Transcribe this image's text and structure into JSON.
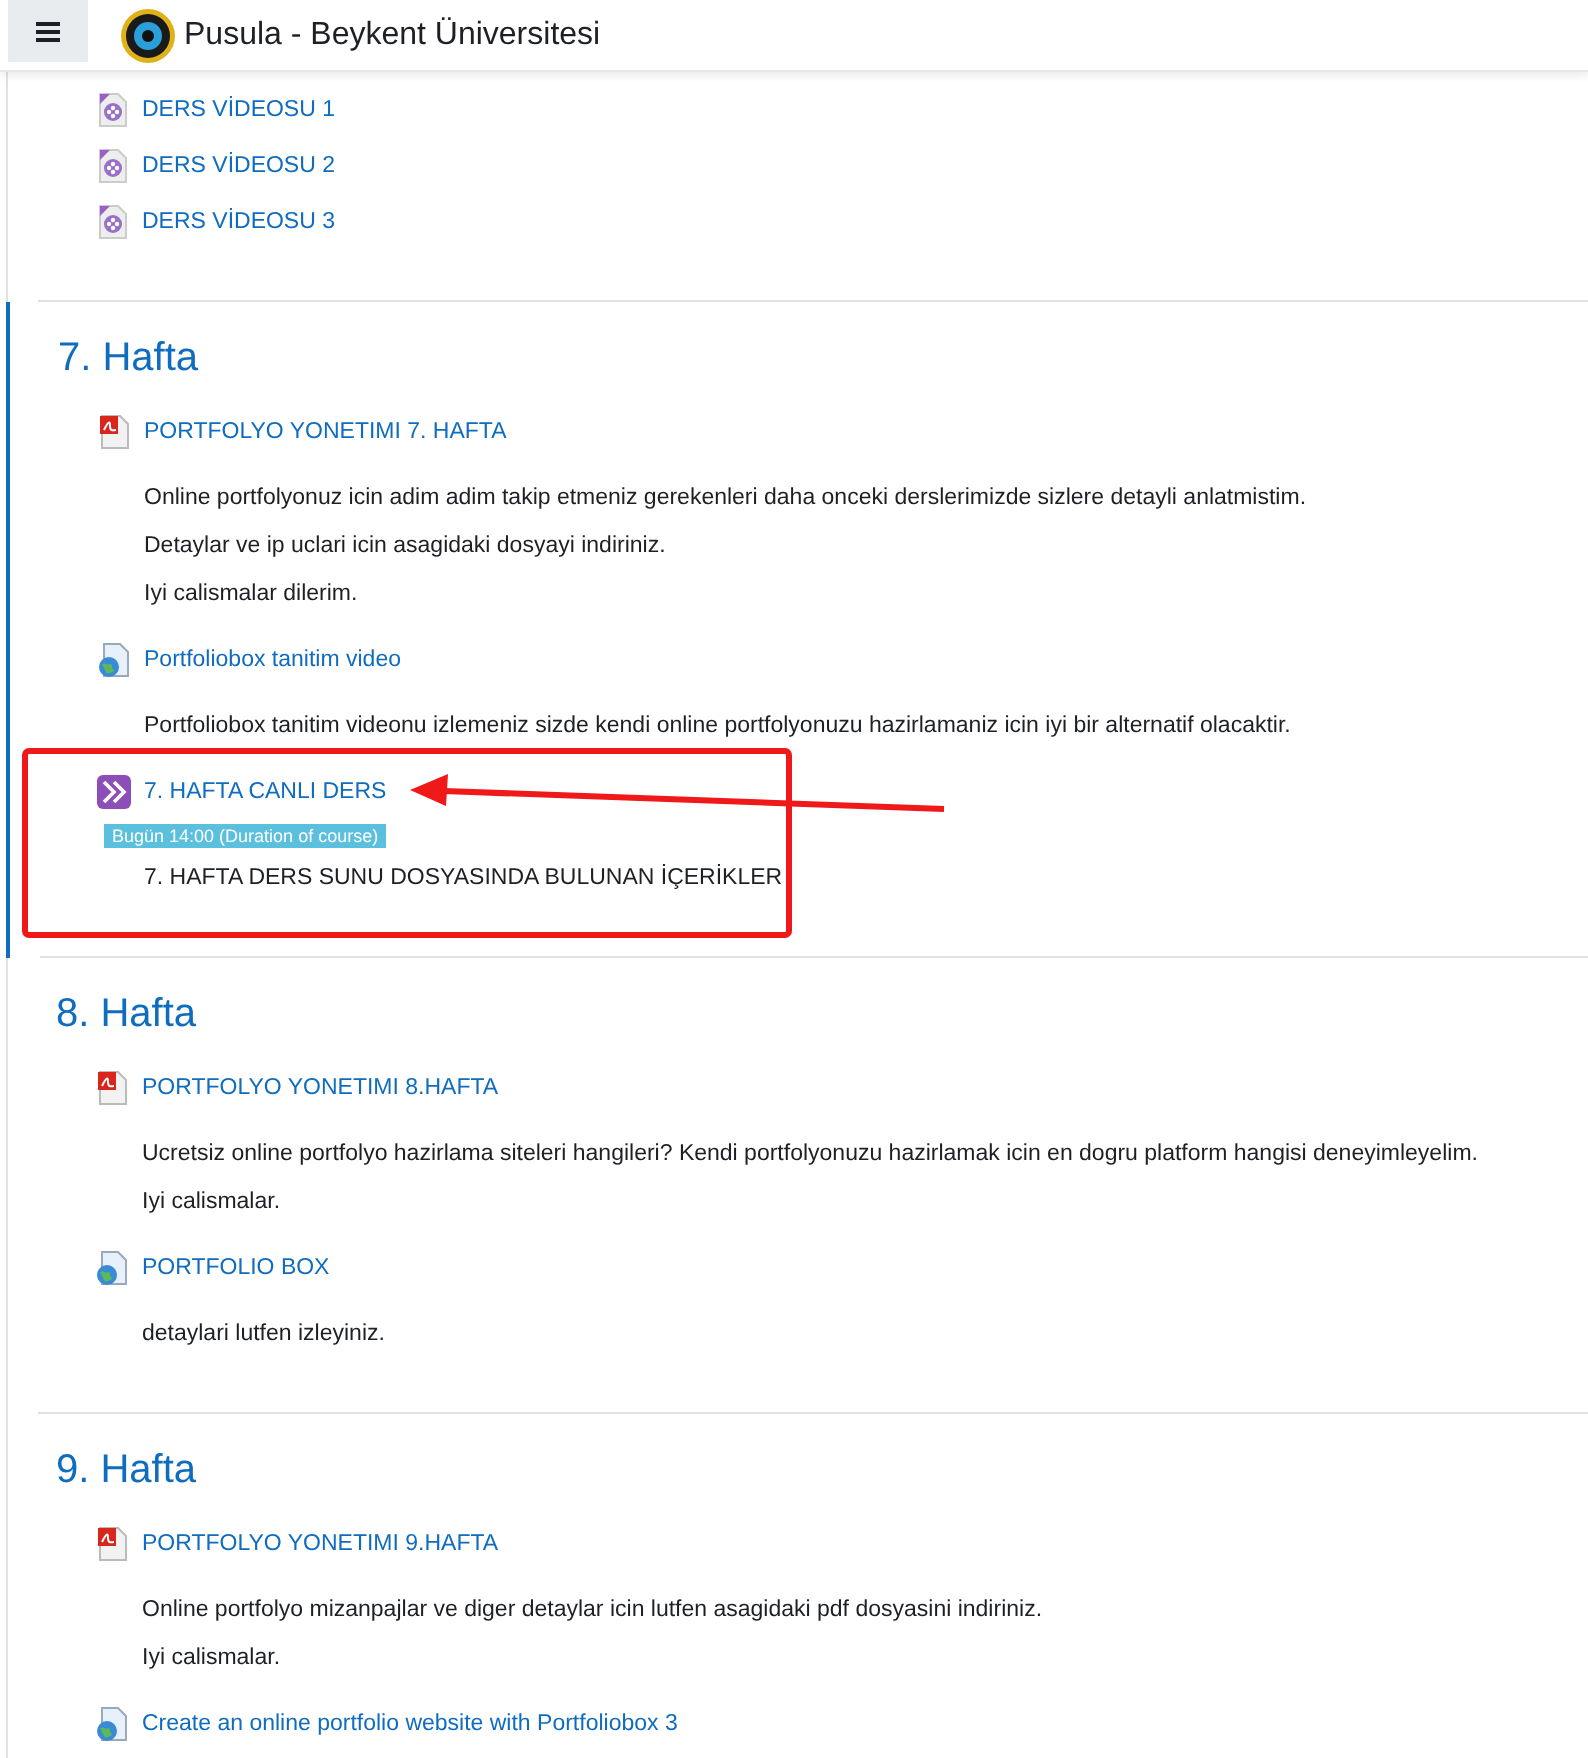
{
  "header": {
    "title": "Pusula - Beykent Üniversitesi"
  },
  "sections": [
    {
      "current": false,
      "activities": [
        {
          "kind": "video",
          "name": "DERS VİDEOSU 1"
        },
        {
          "kind": "video",
          "name": "DERS VİDEOSU 2"
        },
        {
          "kind": "video",
          "name": "DERS VİDEOSU 3"
        }
      ]
    },
    {
      "title": "7. Hafta",
      "current": true,
      "activities": [
        {
          "kind": "pdf",
          "name": "PORTFOLYO YONETIMI 7. HAFTA",
          "description": [
            "Online portfolyonuz icin adim adim takip etmeniz gerekenleri daha onceki derslerimizde sizlere detayli anlatmistim.",
            "Detaylar ve ip uclari icin asagidaki dosyayi indiriniz.",
            "Iyi calismalar dilerim."
          ]
        },
        {
          "kind": "url",
          "name": "Portfoliobox tanitim video",
          "description": [
            "Portfoliobox tanitim videonu izlemeniz sizde kendi online portfolyonuzu hazirlamaniz icin iyi bir alternatif olacaktir."
          ]
        },
        {
          "kind": "live",
          "name": "7. HAFTA CANLI DERS",
          "badge": "Bugün 14:00 (Duration of course)",
          "description": [
            "7. HAFTA DERS SUNU DOSYASINDA BULUNAN İÇERİKLER"
          ]
        }
      ]
    },
    {
      "title": "8. Hafta",
      "current": false,
      "activities": [
        {
          "kind": "pdf",
          "name": "PORTFOLYO YONETIMI 8.HAFTA",
          "description": [
            "Ucretsiz online portfolyo hazirlama siteleri hangileri? Kendi portfolyonuzu hazirlamak icin en dogru platform hangisi deneyimleyelim.",
            "Iyi calismalar."
          ]
        },
        {
          "kind": "url",
          "name": "PORTFOLIO BOX",
          "description": [
            "detaylari lutfen izleyiniz."
          ]
        }
      ]
    },
    {
      "title": "9. Hafta",
      "current": false,
      "activities": [
        {
          "kind": "pdf",
          "name": "PORTFOLYO YONETIMI 9.HAFTA",
          "description": [
            "Online portfolyo mizanpajlar ve diger detaylar icin lutfen asagidaki pdf dosyasini indiriniz.",
            "Iyi calismalar."
          ]
        },
        {
          "kind": "url",
          "name": "Create an online portfolio website with Portfoliobox 3"
        }
      ]
    }
  ]
}
